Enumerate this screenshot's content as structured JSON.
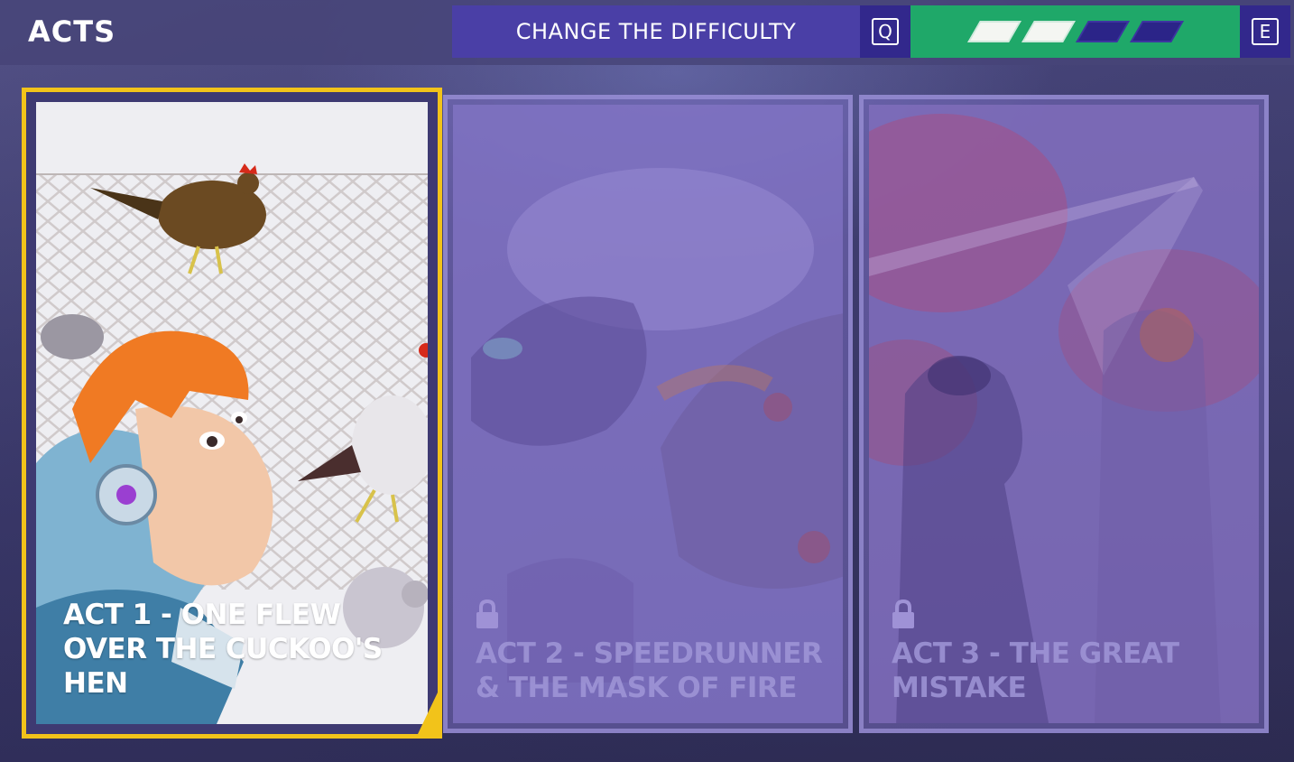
{
  "header": {
    "title": "ACTS"
  },
  "difficulty": {
    "label": "CHANGE THE DIFFICULTY",
    "prev_key": "Q",
    "next_key": "E",
    "level": 2,
    "max_level": 4
  },
  "acts": [
    {
      "title": "ACT 1 - ONE FLEW OVER THE CUCKOO'S HEN",
      "locked": false,
      "selected": true
    },
    {
      "title": "ACT 2 - SPEEDRUNNER & THE MASK OF FIRE",
      "locked": true,
      "selected": false
    },
    {
      "title": "ACT 3 - THE GREAT MISTAKE",
      "locked": true,
      "selected": false
    }
  ],
  "colors": {
    "selection_border": "#f2c31a",
    "difficulty_bar": "#1fa869",
    "difficulty_label_bg": "#4a3fa6"
  }
}
